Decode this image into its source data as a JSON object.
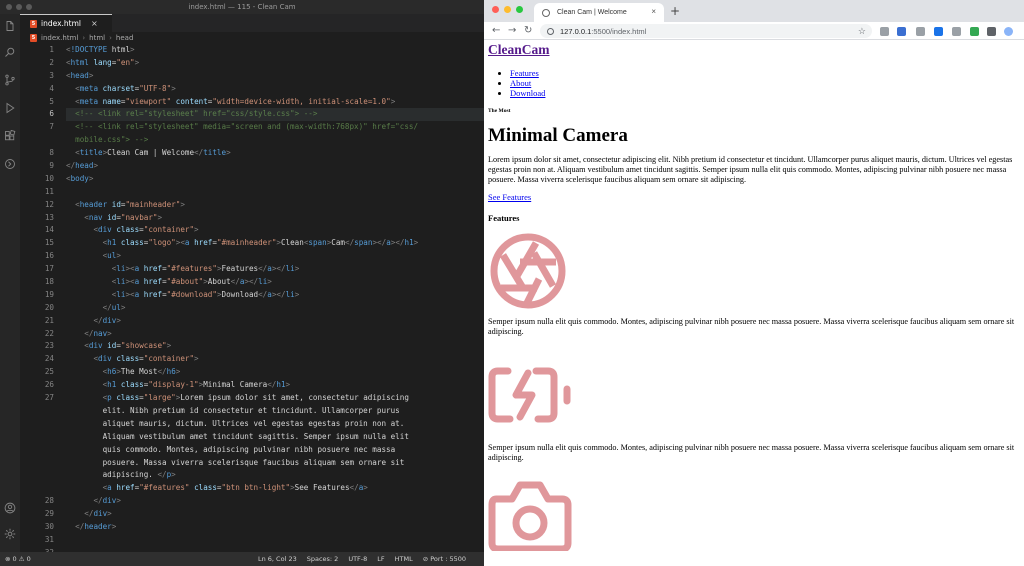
{
  "vscode": {
    "window_title": "index.html — 115 - Clean Cam",
    "tab": {
      "label": "index.html",
      "icon": "html-file-icon"
    },
    "breadcrumb": [
      "index.html",
      "html",
      "head"
    ],
    "activity_icons": [
      "files-icon",
      "search-icon",
      "source-control-icon",
      "run-debug-icon",
      "extensions-icon",
      "remote-icon",
      "account-icon",
      "gear-icon"
    ],
    "line_numbers": [
      "1",
      "2",
      "3",
      "4",
      "5",
      "6",
      "7",
      "",
      "8",
      "9",
      "10",
      "11",
      "12",
      "13",
      "14",
      "15",
      "16",
      "17",
      "18",
      "19",
      "20",
      "21",
      "22",
      "23",
      "24",
      "25",
      "26",
      "27",
      "",
      "",
      "",
      "",
      "",
      "",
      "",
      "28",
      "29",
      "30",
      "31",
      "32"
    ],
    "current_line": "6",
    "code_lines": [
      "<!DOCTYPE html>",
      "<html lang=\"en\">",
      "<head>",
      "  <meta charset=\"UTF-8\">",
      "  <meta name=\"viewport\" content=\"width=device-width, initial-scale=1.0\">",
      "  <!-- <link rel=\"stylesheet\" href=\"css/style.css\"> -->",
      "  <!-- <link rel=\"stylesheet\" media=\"screen and (max-width:768px)\" href=\"css/",
      "  mobile.css\"> -->",
      "  <title>Clean Cam | Welcome</title>",
      "</head>",
      "<body>",
      "",
      "  <header id=\"mainheader\">",
      "    <nav id=\"navbar\">",
      "      <div class=\"container\">",
      "        <h1 class=\"logo\"><a href=\"#mainheader\">Clean<span>Cam</span></a></h1>",
      "        <ul>",
      "          <li><a href=\"#features\">Features</a></li>",
      "          <li><a href=\"#about\">About</a></li>",
      "          <li><a href=\"#download\">Download</a></li>",
      "        </ul>",
      "      </div>",
      "    </nav>",
      "    <div id=\"showcase\">",
      "      <div class=\"container\">",
      "        <h6>The Most</h6>",
      "        <h1 class=\"display-1\">Minimal Camera</h1>",
      "        <p class=\"large\">Lorem ipsum dolor sit amet, consectetur adipiscing",
      "        elit. Nibh pretium id consectetur et tincidunt. Ullamcorper purus",
      "        aliquet mauris, dictum. Ultrices vel egestas egestas proin non at.",
      "        Aliquam vestibulum amet tincidunt sagittis. Semper ipsum nulla elit",
      "        quis commodo. Montes, adipiscing pulvinar nibh posuere nec massa",
      "        posuere. Massa viverra scelerisque faucibus aliquam sem ornare sit",
      "        adipiscing. </p>",
      "        <a href=\"#features\" class=\"btn btn-light\">See Features</a>",
      "      </div>",
      "    </div>",
      "  </header>",
      ""
    ],
    "status": {
      "left": "⊗ 0 ⚠ 0",
      "cursor": "Ln 6, Col 23",
      "spaces": "Spaces: 2",
      "encoding": "UTF-8",
      "eol": "LF",
      "language": "HTML",
      "port": "⊘ Port : 5500"
    }
  },
  "browser": {
    "tab_title": "Clean Cam | Welcome",
    "url_host": "127.0.0.1",
    "url_path": ":5500/index.html",
    "page": {
      "logo": "CleanCam",
      "nav": [
        "Features",
        "About",
        "Download"
      ],
      "h6": "The Most",
      "heading": "Minimal Camera",
      "intro": "Lorem ipsum dolor sit amet, consectetur adipiscing elit. Nibh pretium id consectetur et tincidunt. Ullamcorper purus aliquet mauris, dictum. Ultrices vel egestas egestas proin non at. Aliquam vestibulum amet tincidunt sagittis. Semper ipsum nulla elit quis commodo. Montes, adipiscing pulvinar nibh posuere nec massa posuere. Massa viverra scelerisque faucibus aliquam sem ornare sit adipiscing.",
      "cta": "See Features",
      "features_heading": "Features",
      "features": [
        {
          "icon": "aperture-icon",
          "text": "Semper ipsum nulla elit quis commodo. Montes, adipiscing pulvinar nibh posuere nec massa posuere. Massa viverra scelerisque faucibus aliquam sem ornare sit adipiscing."
        },
        {
          "icon": "battery-charging-icon",
          "text": "Semper ipsum nulla elit quis commodo. Montes, adipiscing pulvinar nibh posuere nec massa posuere. Massa viverra scelerisque faucibus aliquam sem ornare sit adipiscing."
        },
        {
          "icon": "camera-icon",
          "text": ""
        }
      ]
    }
  },
  "colors": {
    "icon_pink": "#e0979b",
    "vscode_bg": "#1e1e1e",
    "link": "#0000ee",
    "visited_link": "#551a8b"
  }
}
